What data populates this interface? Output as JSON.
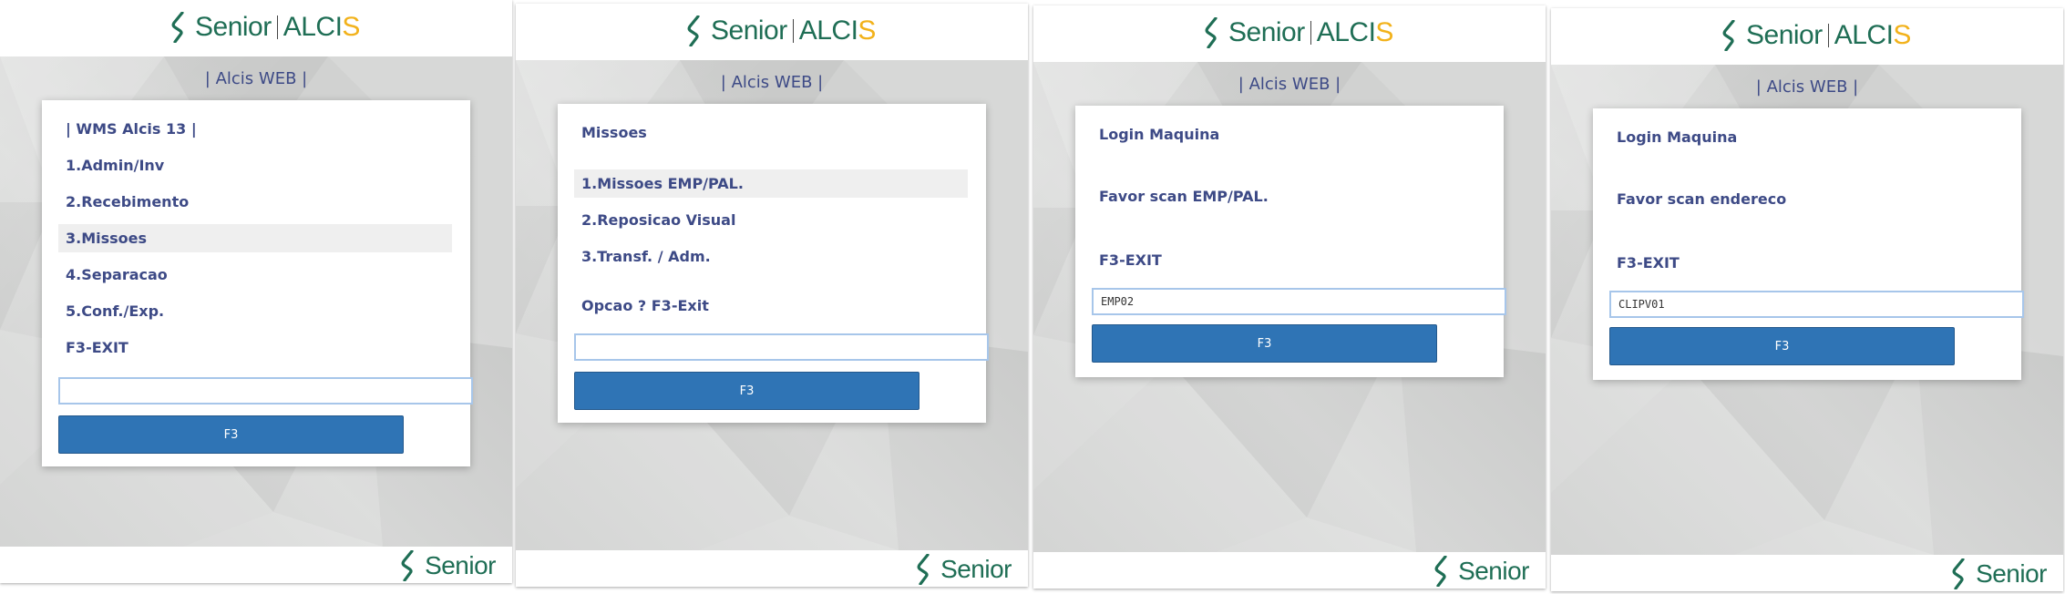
{
  "brand": {
    "senior": "Senior",
    "alcis_main": "ALCI",
    "alcis_s": "S",
    "green": "#1f6e55",
    "yellow": "#f2b21b",
    "button_blue": "#2f74b5",
    "text_navy": "#3d4a86"
  },
  "screens": [
    {
      "subtitle": "| Alcis WEB |",
      "title": "| WMS Alcis 13 |",
      "items": [
        "1.Admin/Inv",
        "2.Recebimento",
        "3.Missoes",
        "4.Separacao",
        "5.Conf./Exp.",
        "F3-EXIT"
      ],
      "selected_item": "3.Missoes",
      "input_value": "",
      "button": "F3",
      "footer": "Senior"
    },
    {
      "subtitle": "| Alcis WEB |",
      "title": "Missoes",
      "items": [
        "1.Missoes EMP/PAL.",
        "2.Reposicao Visual",
        "3.Transf. / Adm."
      ],
      "selected_item": "1.Missoes EMP/PAL.",
      "prompt": "Opcao ? F3-Exit",
      "input_value": "",
      "button": "F3",
      "footer": "Senior"
    },
    {
      "subtitle": "| Alcis WEB |",
      "title": "Login Maquina",
      "message": "Favor scan EMP/PAL.",
      "exit": "F3-EXIT",
      "input_value": "EMP02",
      "button": "F3",
      "footer": "Senior"
    },
    {
      "subtitle": "| Alcis WEB |",
      "title": "Login Maquina",
      "message": "Favor scan endereco",
      "exit": "F3-EXIT",
      "input_value": "CLIPV01",
      "button": "F3",
      "footer": "Senior"
    }
  ]
}
